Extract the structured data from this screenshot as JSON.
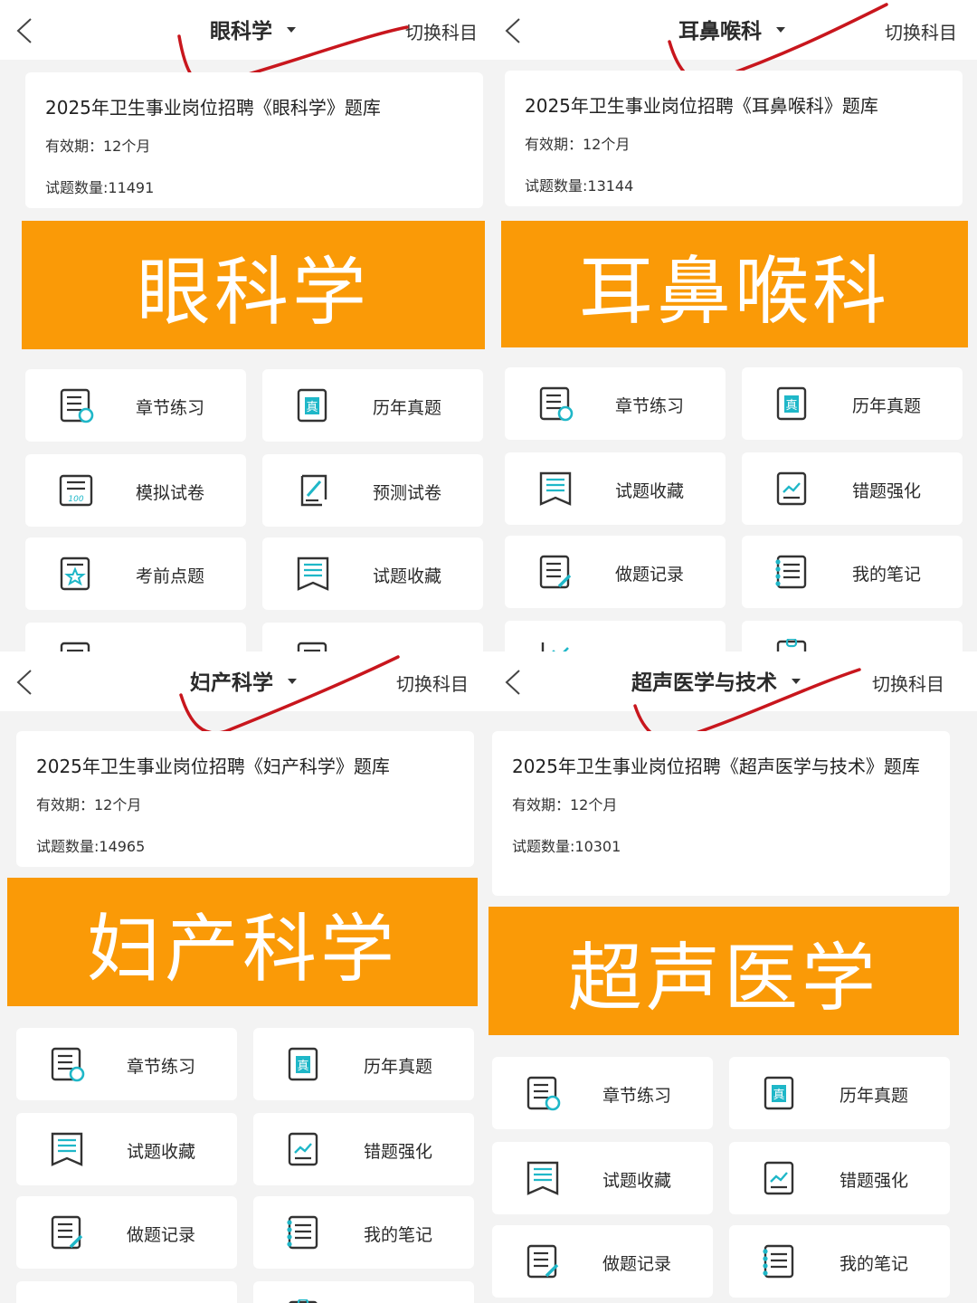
{
  "colors": {
    "accent": "#fa9a07",
    "icon_dark": "#333333",
    "icon_teal": "#1fb7c8",
    "tick_red": "#c8161d",
    "background": "#f3f3f3"
  },
  "common": {
    "switch_label": "切换科目"
  },
  "panels": [
    {
      "subject": "眼科学",
      "card": {
        "title": "2025年卫生事业岗位招聘《眼科学》题库",
        "validity": "有效期：12个月",
        "count": "试题数量:11491"
      },
      "banner": "眼科学",
      "tiles": [
        {
          "label": "章节练习",
          "icon": "chapter-practice-icon"
        },
        {
          "label": "历年真题",
          "icon": "past-papers-icon"
        },
        {
          "label": "模拟试卷",
          "icon": "mock-exam-icon"
        },
        {
          "label": "预测试卷",
          "icon": "forecast-exam-icon"
        },
        {
          "label": "考前点题",
          "icon": "pre-exam-tips-icon"
        },
        {
          "label": "试题收藏",
          "icon": "favorites-icon"
        },
        {
          "label": "",
          "icon": "document-icon"
        },
        {
          "label": "",
          "icon": "document-icon"
        }
      ]
    },
    {
      "subject": "耳鼻喉科",
      "card": {
        "title": "2025年卫生事业岗位招聘《耳鼻喉科》题库",
        "validity": "有效期：12个月",
        "count": "试题数量:13144"
      },
      "banner": "耳鼻喉科",
      "tiles": [
        {
          "label": "章节练习",
          "icon": "chapter-practice-icon"
        },
        {
          "label": "历年真题",
          "icon": "past-papers-icon"
        },
        {
          "label": "试题收藏",
          "icon": "favorites-icon"
        },
        {
          "label": "错题强化",
          "icon": "wrong-answers-icon"
        },
        {
          "label": "做题记录",
          "icon": "answer-record-icon"
        },
        {
          "label": "我的笔记",
          "icon": "notes-icon"
        },
        {
          "label": "",
          "icon": "chart-icon"
        },
        {
          "label": "",
          "icon": "feedback-icon"
        }
      ]
    },
    {
      "subject": "妇产科学",
      "card": {
        "title": "2025年卫生事业岗位招聘《妇产科学》题库",
        "validity": "有效期：12个月",
        "count": "试题数量:14965"
      },
      "banner": "妇产科学",
      "tiles": [
        {
          "label": "章节练习",
          "icon": "chapter-practice-icon"
        },
        {
          "label": "历年真题",
          "icon": "past-papers-icon"
        },
        {
          "label": "试题收藏",
          "icon": "favorites-icon"
        },
        {
          "label": "错题强化",
          "icon": "wrong-answers-icon"
        },
        {
          "label": "做题记录",
          "icon": "answer-record-icon"
        },
        {
          "label": "我的笔记",
          "icon": "notes-icon"
        },
        {
          "label": "",
          "icon": "chart-icon"
        },
        {
          "label": "",
          "icon": "feedback-icon"
        }
      ]
    },
    {
      "subject": "超声医学与技术",
      "card": {
        "title": "2025年卫生事业岗位招聘《超声医学与技术》题库",
        "validity": "有效期：12个月",
        "count": "试题数量:10301"
      },
      "banner": "超声医学",
      "tiles": [
        {
          "label": "章节练习",
          "icon": "chapter-practice-icon"
        },
        {
          "label": "历年真题",
          "icon": "past-papers-icon"
        },
        {
          "label": "试题收藏",
          "icon": "favorites-icon"
        },
        {
          "label": "错题强化",
          "icon": "wrong-answers-icon"
        },
        {
          "label": "做题记录",
          "icon": "answer-record-icon"
        },
        {
          "label": "我的笔记",
          "icon": "notes-icon"
        }
      ]
    }
  ]
}
